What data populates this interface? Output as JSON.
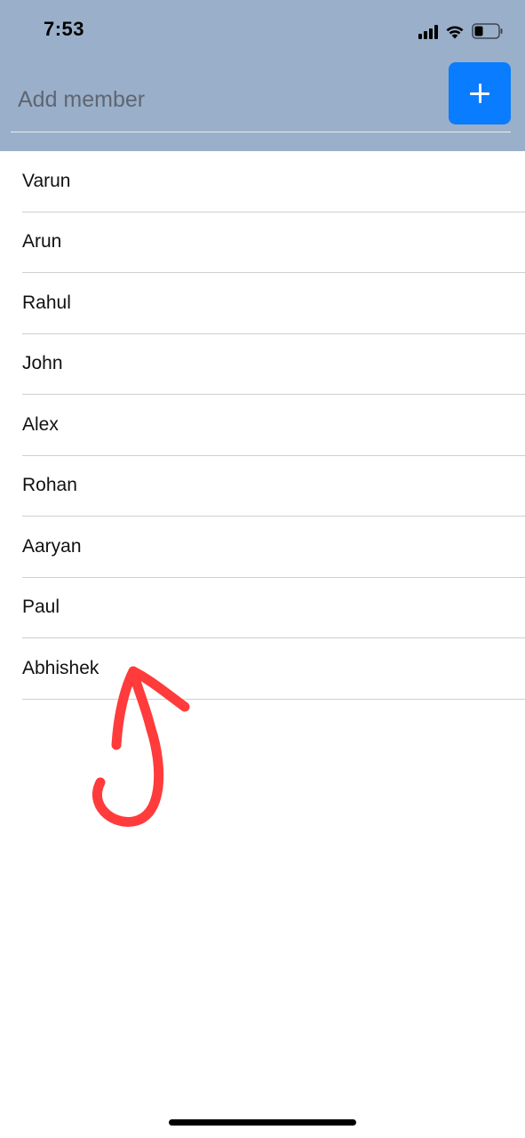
{
  "status_bar": {
    "time": "7:53",
    "icons": [
      "signal-icon",
      "wifi-icon",
      "battery-icon"
    ]
  },
  "add_member": {
    "placeholder": "Add member",
    "value": "",
    "button_icon": "plus-icon",
    "button_color": "#0a7cff"
  },
  "header_color": "#9aafc9",
  "members": [
    {
      "name": "Varun"
    },
    {
      "name": "Arun"
    },
    {
      "name": "Rahul"
    },
    {
      "name": "John"
    },
    {
      "name": "Alex"
    },
    {
      "name": "Rohan"
    },
    {
      "name": "Aaryan"
    },
    {
      "name": "Paul"
    },
    {
      "name": "Abhishek"
    }
  ],
  "annotation": {
    "icon": "hand-drawn-arrow-icon",
    "color": "#ff3b3b"
  }
}
